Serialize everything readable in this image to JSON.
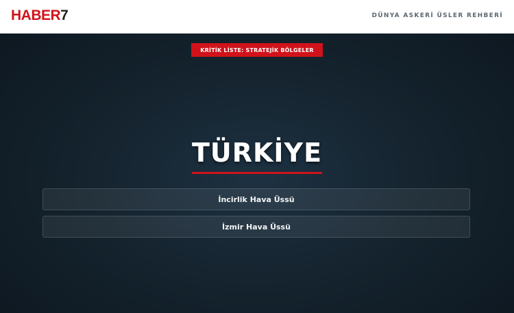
{
  "header": {
    "logo_main": "HABER",
    "logo_number": "7",
    "guide_title": "DÜNYA ASKERİ ÜSLER REHBERİ"
  },
  "main": {
    "badge": "KRİTİK LİSTE: STRATEJİK BÖLGELER",
    "country": "TÜRKİYE",
    "bases": [
      {
        "label": "İncirlik Hava Üssü"
      },
      {
        "label": "İzmir Hava Üssü"
      }
    ]
  },
  "colors": {
    "accent": "#d1121a",
    "background": "#0f1a24",
    "header_bg": "#ffffff"
  }
}
